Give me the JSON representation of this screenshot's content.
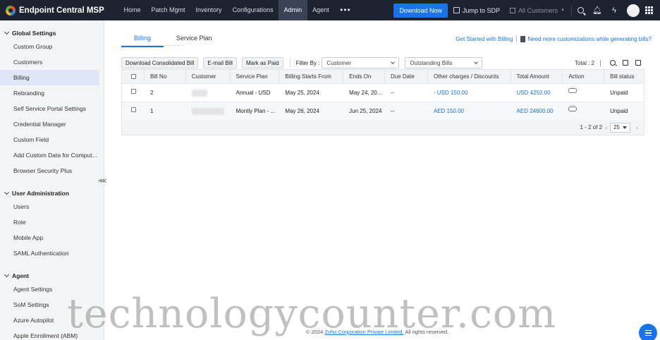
{
  "app": {
    "brand": "Endpoint Central MSP"
  },
  "nav": {
    "items": [
      {
        "label": "Home"
      },
      {
        "label": "Patch Mgmt"
      },
      {
        "label": "Inventory"
      },
      {
        "label": "Configurations"
      },
      {
        "label": "Admin",
        "active": true
      },
      {
        "label": "Agent"
      }
    ],
    "more": "•••",
    "download_button": "Download Now",
    "jump_label": "Jump to SDP",
    "customer_select": "All Customers"
  },
  "sidebar": {
    "sections": [
      {
        "title": "Global Settings",
        "items": [
          "Custom Group",
          "Customers",
          "Billing",
          "Rebranding",
          "Self Service Portal Settings",
          "Credential Manager",
          "Custom Field",
          "Add Custom Data for Comput...",
          "Browser Security Plus"
        ]
      },
      {
        "title": "User Administration",
        "items": [
          "Users",
          "Role",
          "Mobile App",
          "SAML Authentication"
        ]
      },
      {
        "title": "Agent",
        "items": [
          "Agent Settings",
          "SoM Settings",
          "Azure Autopilot",
          "Apple Enrollment (ABM)"
        ]
      }
    ],
    "active_item": "Billing"
  },
  "tabs": {
    "billing": "Billing",
    "service_plan": "Service Plan"
  },
  "links": {
    "get_started": "Get Started with Billing",
    "customizations": "Need more customizations while generating bills?"
  },
  "toolbar": {
    "download_consolidated": "Download Consolidated Bill",
    "email_bill": "E-mail Bill",
    "mark_paid": "Mark as Paid",
    "filter_label": "Filter By :",
    "filter_value": "Customer",
    "bills_filter": "Outstanding Bills",
    "total": "Total : 2"
  },
  "table": {
    "headers": [
      "Bill No",
      "Customer",
      "Service Plan",
      "Billing Starts From",
      "Ends On",
      "Due Date",
      "Other charges / Discounts",
      "Total Amount",
      "Action",
      "Bill status"
    ],
    "rows": [
      {
        "bill_no": "2",
        "service_plan": "Annual - USD",
        "billing_start": "May 25, 2024",
        "ends_on": "May 24, 20...",
        "due_date": "--",
        "other_charges": "- USD 150.00",
        "total": "USD 4250.00",
        "status": "Unpaid"
      },
      {
        "bill_no": "1",
        "service_plan": "Montly Plan - ...",
        "billing_start": "May 26, 2024",
        "ends_on": "Jun 25, 2024",
        "due_date": "--",
        "other_charges": "AED 150.00",
        "total": "AED 24600.00",
        "status": "Unpaid"
      }
    ],
    "pagination": {
      "range": "1 - 2 of 2",
      "page_size": "25"
    }
  },
  "footer": {
    "prefix": "© 2024",
    "company": "Zoho Corporation Private Limited.",
    "suffix": "All rights reserved."
  },
  "watermark": "technologycounter.com",
  "colors": {
    "accent": "#1a73e8",
    "topbar": "#1d2330"
  }
}
